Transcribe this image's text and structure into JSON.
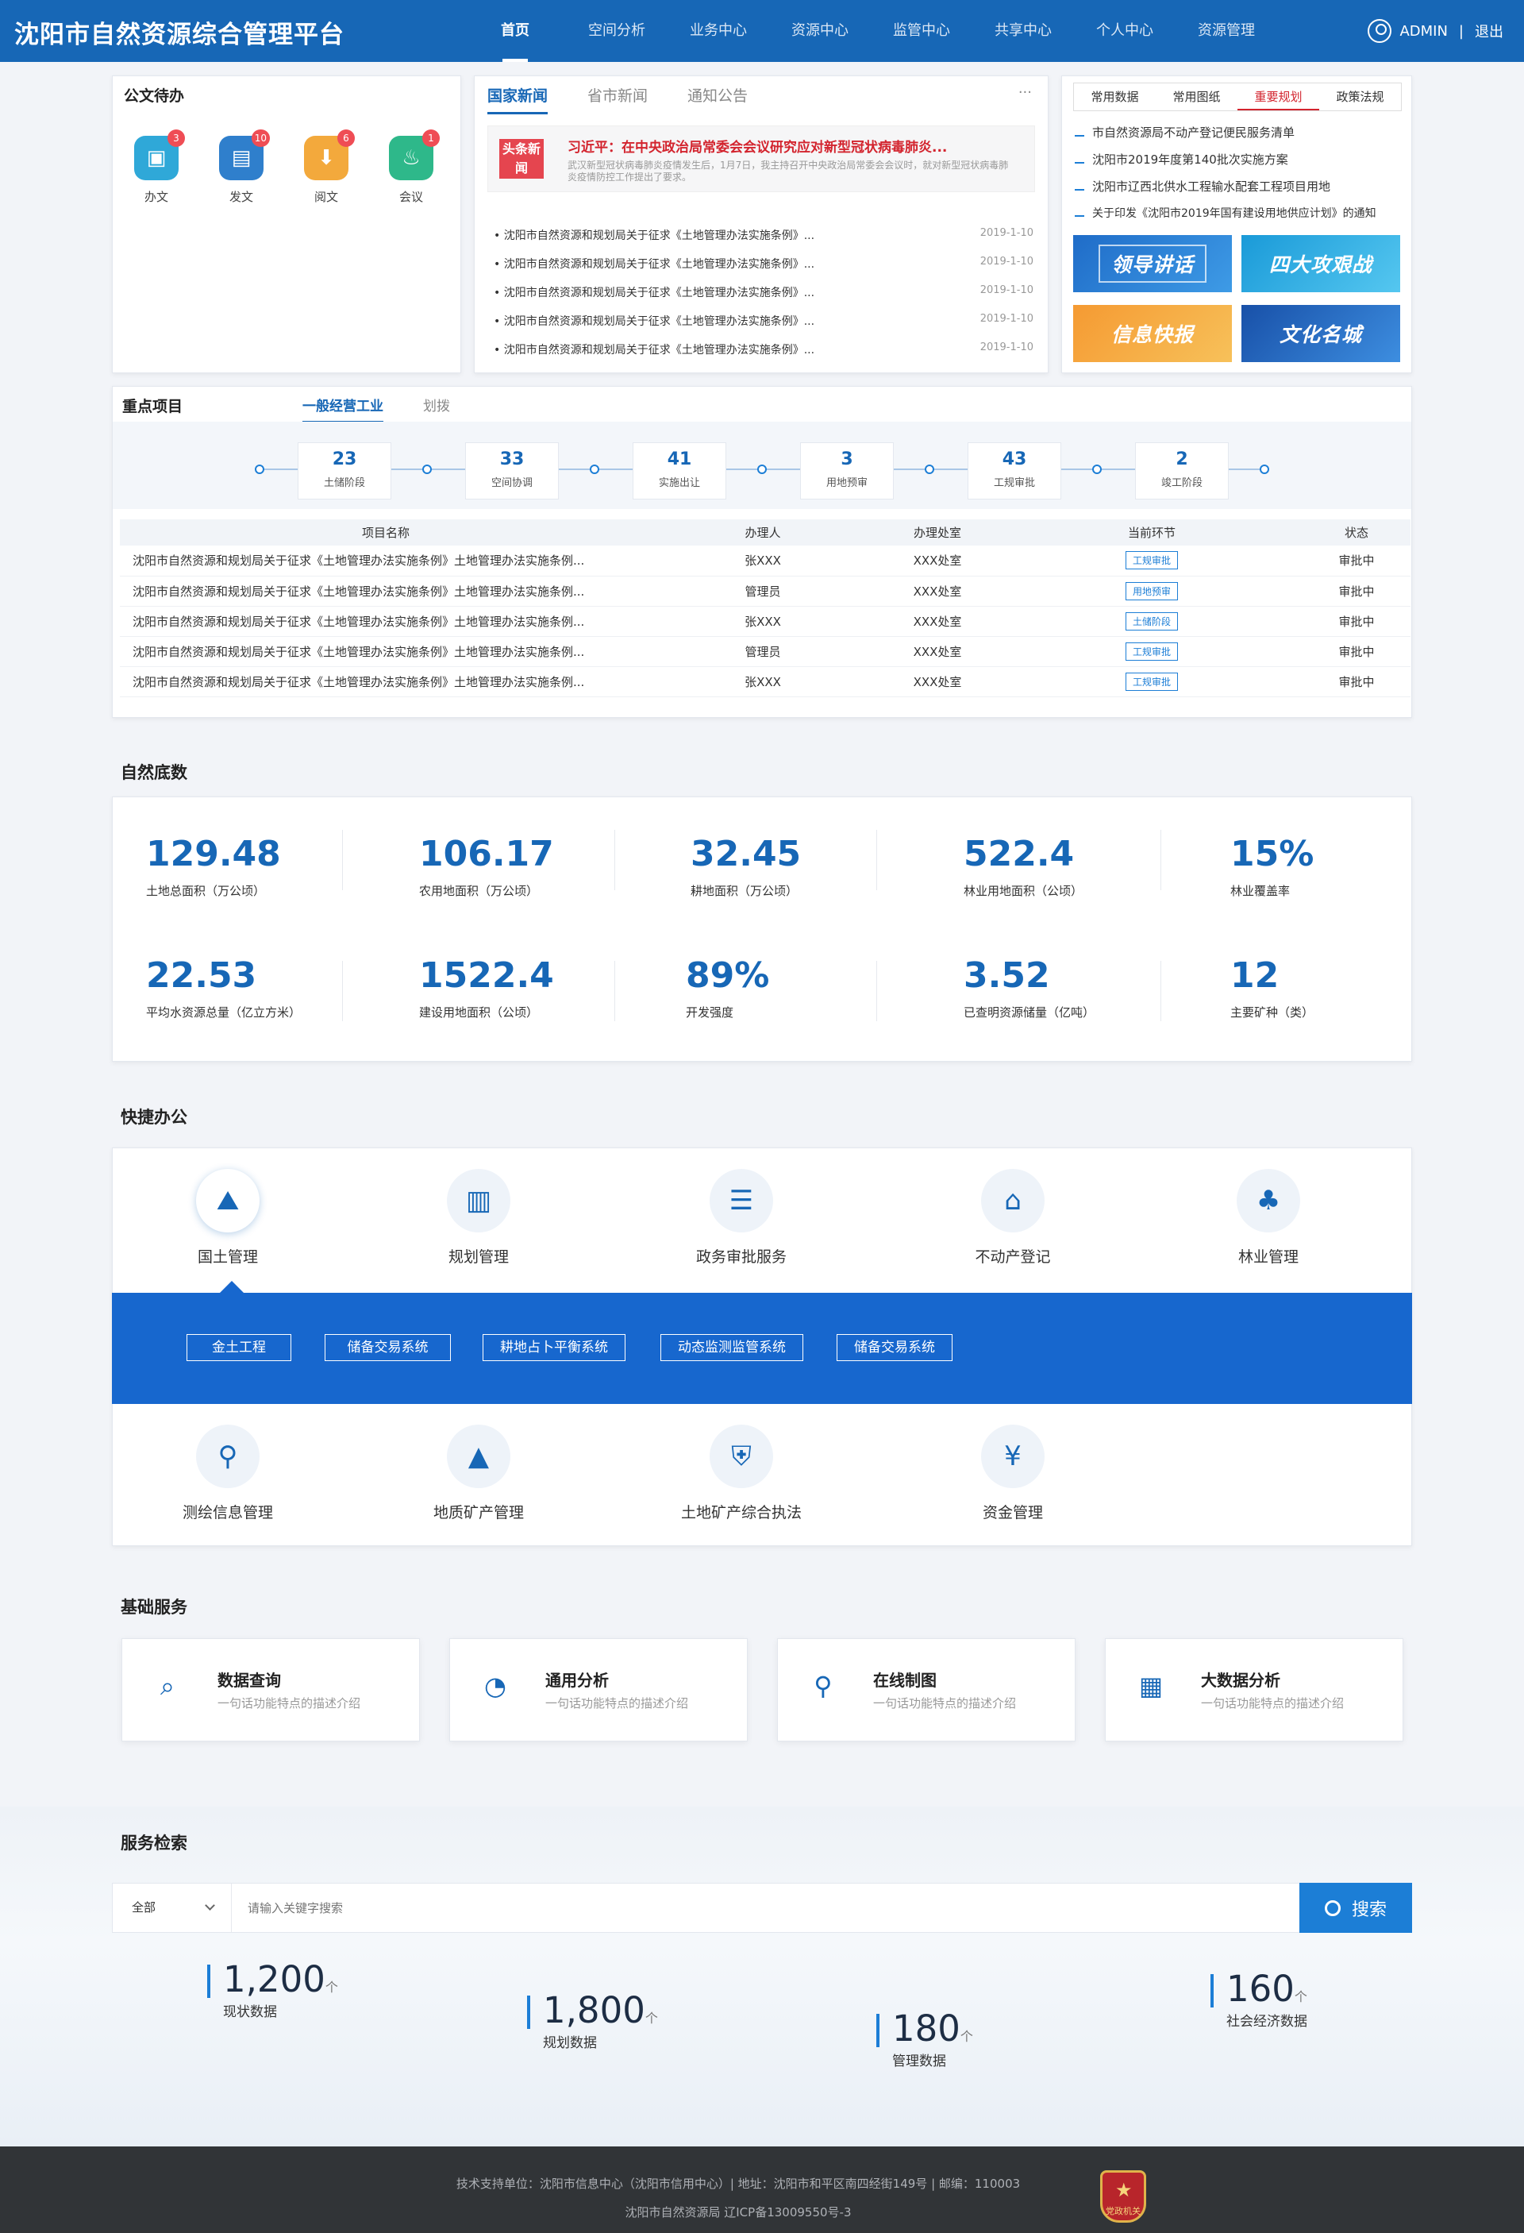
{
  "app": {
    "title": "沈阳市自然资源综合管理平台"
  },
  "nav": {
    "items": [
      "首页",
      "空间分析",
      "业务中心",
      "资源中心",
      "监管中心",
      "共享中心",
      "个人中心",
      "资源管理"
    ],
    "user": "ADMIN",
    "sep": "|",
    "logout": "退出"
  },
  "todo": {
    "title": "公文待办",
    "items": [
      {
        "label": "办文",
        "badge": "3",
        "color": "#2fa8d8"
      },
      {
        "label": "发文",
        "badge": "10",
        "color": "#2f7fcc"
      },
      {
        "label": "阅文",
        "badge": "6",
        "color": "#f3a93c"
      },
      {
        "label": "会议",
        "badge": "1",
        "color": "#2eb88a"
      }
    ]
  },
  "news": {
    "tabs": [
      "国家新闻",
      "省市新闻",
      "通知公告"
    ],
    "more": "···",
    "headline_tag": "头条新闻",
    "headline": "习近平：在中央政治局常委会会议研究应对新型冠状病毒肺炎...",
    "headline_desc": "武汉新型冠状病毒肺炎疫情发生后，1月7日，我主持召开中央政治局常委会会议时，就对新型冠状病毒肺炎疫情防控工作提出了要求。",
    "rows": [
      {
        "t": "• 沈阳市自然资源和规划局关于征求《土地管理办法实施条例》...",
        "d": "2019-1-10"
      },
      {
        "t": "• 沈阳市自然资源和规划局关于征求《土地管理办法实施条例》...",
        "d": "2019-1-10"
      },
      {
        "t": "• 沈阳市自然资源和规划局关于征求《土地管理办法实施条例》...",
        "d": "2019-1-10"
      },
      {
        "t": "• 沈阳市自然资源和规划局关于征求《土地管理办法实施条例》...",
        "d": "2019-1-10"
      },
      {
        "t": "• 沈阳市自然资源和规划局关于征求《土地管理办法实施条例》...",
        "d": "2019-1-10"
      }
    ]
  },
  "kb": {
    "tabs": [
      "常用数据",
      "常用图纸",
      "重要规划",
      "政策法规"
    ],
    "items": [
      "市自然资源局不动产登记便民服务清单",
      "沈阳市2019年度第140批次实施方案",
      "沈阳市辽西北供水工程输水配套工程项目用地",
      "关于印发《沈阳市2019年国有建设用地供应计划》的通知"
    ],
    "banners": [
      "领导讲话",
      "四大攻艰战",
      "信息快报",
      "文化名城"
    ]
  },
  "projects": {
    "title": "重点项目",
    "tabs": [
      "一般经营工业",
      "划拨"
    ],
    "steps": [
      {
        "n": "23",
        "l": "土储阶段"
      },
      {
        "n": "33",
        "l": "空间协调"
      },
      {
        "n": "41",
        "l": "实施出让"
      },
      {
        "n": "3",
        "l": "用地预审"
      },
      {
        "n": "43",
        "l": "工规审批"
      },
      {
        "n": "2",
        "l": "竣工阶段"
      }
    ],
    "headers": [
      "项目名称",
      "办理人",
      "办理处室",
      "当前环节",
      "状态"
    ],
    "rows": [
      {
        "name": "沈阳市自然资源和规划局关于征求《土地管理办法实施条例》土地管理办法实施条例...",
        "p": "张XXX",
        "o": "XXX处室",
        "s": "工规审批",
        "st": "审批中"
      },
      {
        "name": "沈阳市自然资源和规划局关于征求《土地管理办法实施条例》土地管理办法实施条例...",
        "p": "管理员",
        "o": "XXX处室",
        "s": "用地预审",
        "st": "审批中"
      },
      {
        "name": "沈阳市自然资源和规划局关于征求《土地管理办法实施条例》土地管理办法实施条例...",
        "p": "张XXX",
        "o": "XXX处室",
        "s": "土储阶段",
        "st": "审批中"
      },
      {
        "name": "沈阳市自然资源和规划局关于征求《土地管理办法实施条例》土地管理办法实施条例...",
        "p": "管理员",
        "o": "XXX处室",
        "s": "工规审批",
        "st": "审批中"
      },
      {
        "name": "沈阳市自然资源和规划局关于征求《土地管理办法实施条例》土地管理办法实施条例...",
        "p": "张XXX",
        "o": "XXX处室",
        "s": "工规审批",
        "st": "审批中"
      }
    ]
  },
  "nature": {
    "title": "自然底数",
    "stats": [
      {
        "v": "129.48",
        "l": "土地总面积（万公顷）"
      },
      {
        "v": "106.17",
        "l": "农用地面积（万公顷）"
      },
      {
        "v": "32.45",
        "l": "耕地面积（万公顷）"
      },
      {
        "v": "522.4",
        "l": "林业用地面积（公顷）"
      },
      {
        "v": "15%",
        "l": "林业覆盖率"
      },
      {
        "v": "22.53",
        "l": "平均水资源总量（亿立方米）"
      },
      {
        "v": "1522.4",
        "l": "建设用地面积（公顷）"
      },
      {
        "v": "89%",
        "l": "开发强度"
      },
      {
        "v": "3.52",
        "l": "已查明资源储量（亿吨）"
      },
      {
        "v": "12",
        "l": "主要矿种（类）"
      }
    ]
  },
  "quick": {
    "title": "快捷办公",
    "items": [
      "国土管理",
      "规划管理",
      "政务审批服务",
      "不动产登记",
      "林业管理"
    ],
    "subs": [
      "金土工程",
      "储备交易系统",
      "耕地占卜平衡系统",
      "动态监测监管系统",
      "储备交易系统"
    ],
    "items2": [
      "测绘信息管理",
      "地质矿产管理",
      "土地矿产综合执法",
      "资金管理"
    ]
  },
  "basic": {
    "title": "基础服务",
    "items": [
      {
        "t": "数据查询",
        "s": "一句话功能特点的描述介绍"
      },
      {
        "t": "通用分析",
        "s": "一句话功能特点的描述介绍"
      },
      {
        "t": "在线制图",
        "s": "一句话功能特点的描述介绍"
      },
      {
        "t": "大数据分析",
        "s": "一句话功能特点的描述介绍"
      }
    ]
  },
  "search": {
    "title": "服务检索",
    "scope": "全部",
    "placeholder": "请输入关键字搜索",
    "button": "搜索",
    "counts": [
      {
        "v": "1,200",
        "u": "个",
        "l": "现状数据"
      },
      {
        "v": "1,800",
        "u": "个",
        "l": "规划数据"
      },
      {
        "v": "180",
        "u": "个",
        "l": "管理数据"
      },
      {
        "v": "160",
        "u": "个",
        "l": "社会经济数据"
      }
    ]
  },
  "footer": {
    "line1": "技术支持单位：沈阳市信息中心（沈阳市信用中心）|  地址：沈阳市和平区南四经街149号  |  邮编：110003",
    "line2": "沈阳市自然资源局    辽ICP备13009550号-3",
    "badge": "党政机关"
  }
}
